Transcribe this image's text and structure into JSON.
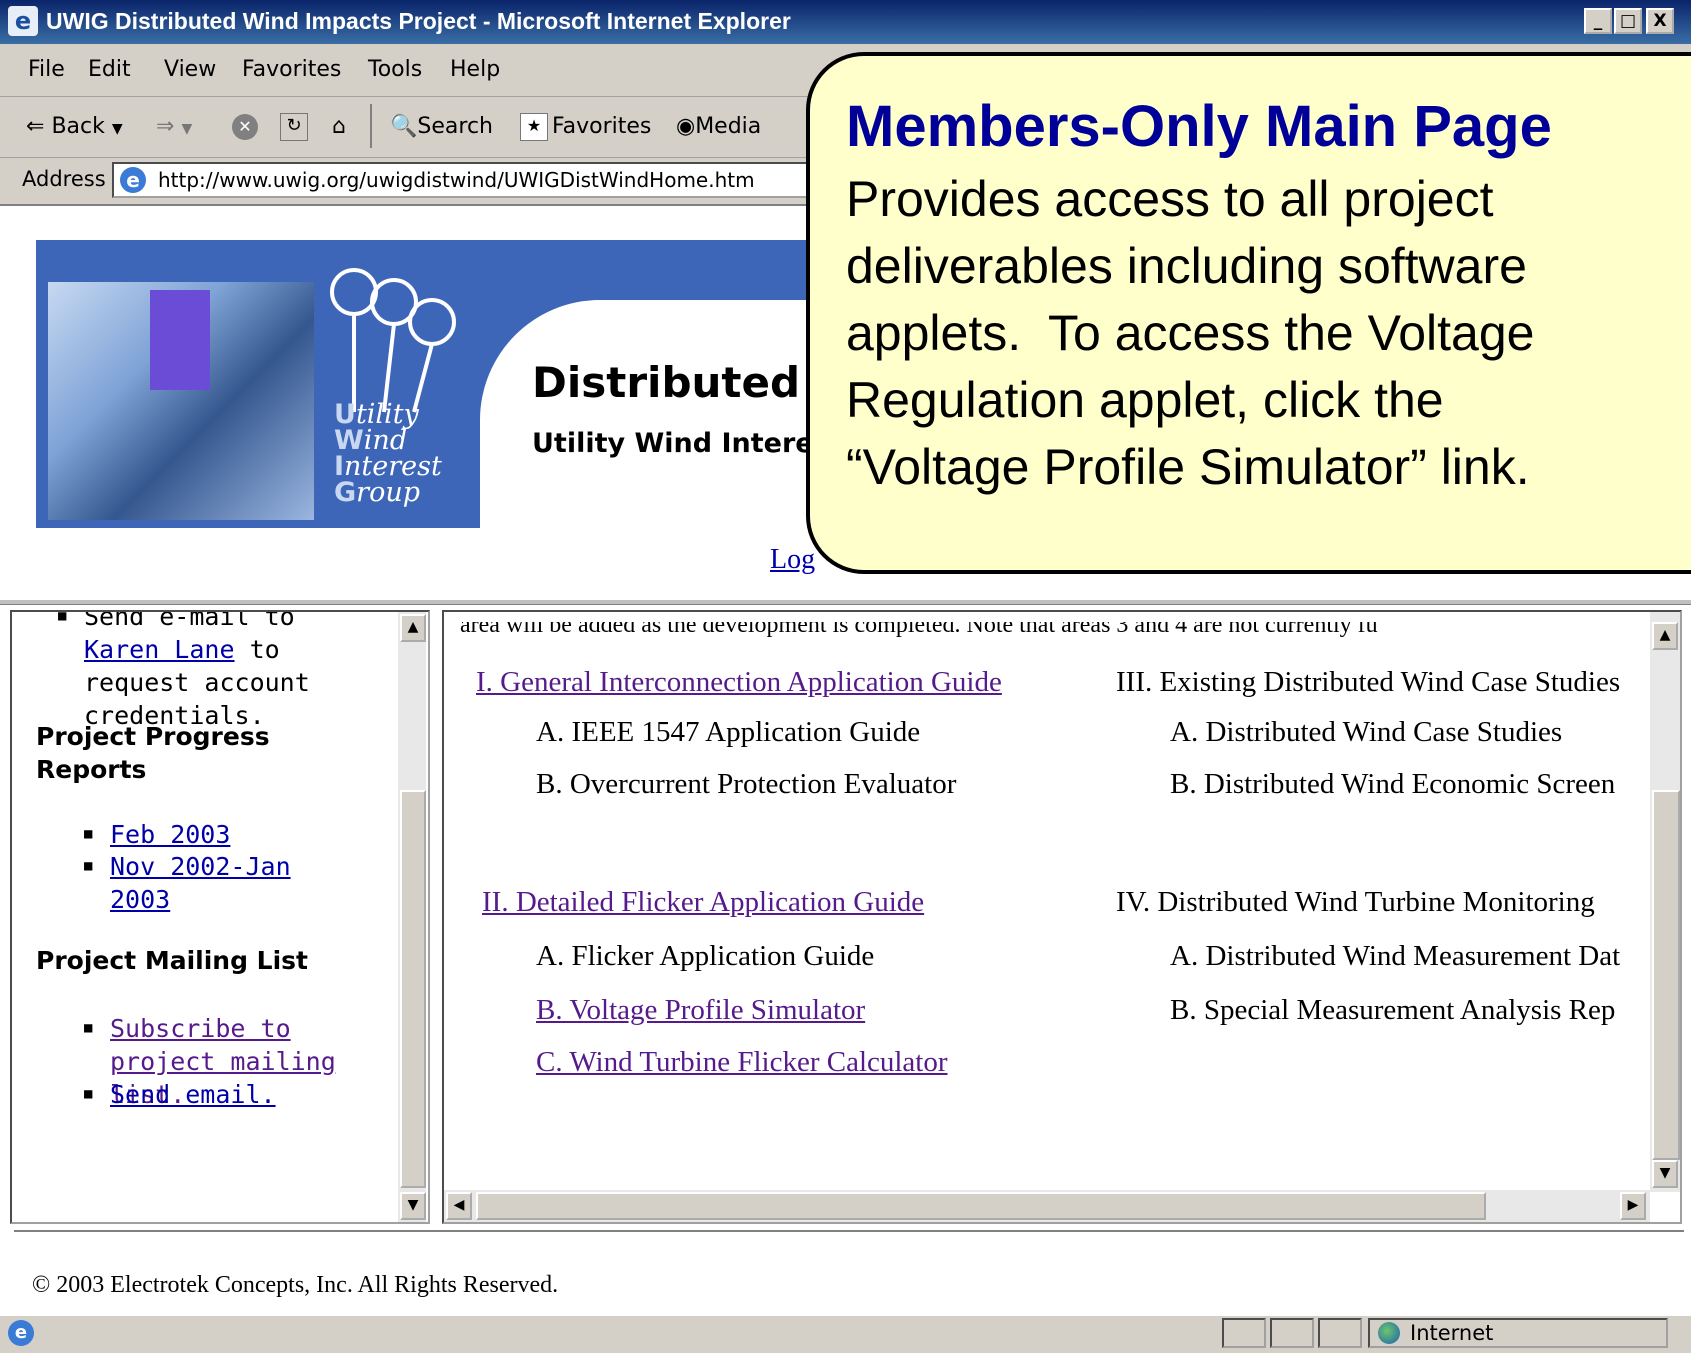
{
  "window": {
    "title": "UWIG Distributed Wind Impacts Project - Microsoft Internet Explorer",
    "controls": {
      "minimize": "_",
      "maximize": "□",
      "close": "X"
    }
  },
  "menubar": {
    "items": [
      "File",
      "Edit",
      "View",
      "Favorites",
      "Tools",
      "Help"
    ]
  },
  "toolbar": {
    "back": "Back",
    "search": "Search",
    "favorites": "Favorites",
    "media": "Media"
  },
  "address": {
    "label": "Address",
    "url": "http://www.uwig.org/uwigdistwind/UWIGDistWindHome.htm"
  },
  "banner": {
    "logo_lines": [
      "tility",
      "ind",
      "nterest",
      "roup"
    ],
    "logo_initials": [
      "U",
      "W",
      "I",
      "G"
    ],
    "title": "Distributed",
    "subtitle": "Utility Wind Intere",
    "login": "Log"
  },
  "left_frame": {
    "email_bullet": {
      "text_pre": "Send e-mail to",
      "link": "Karen Lane",
      "text_post": " to request account credentials."
    },
    "progress_heading": "Project Progress Reports",
    "progress_links": [
      "Feb 2003",
      "Nov 2002-Jan 2003"
    ],
    "mailing_heading": "Project Mailing List",
    "mailing_links": [
      "Subscribe to project mailing list.",
      "Send email."
    ]
  },
  "right_frame": {
    "cutoff_text": "area will be added as the development is completed. Note that areas 3 and 4 are not currently fu",
    "col1": {
      "section1": {
        "title": "I. General Interconnection Application Guide",
        "items": [
          "A. IEEE 1547 Application Guide",
          "B. Overcurrent Protection Evaluator"
        ]
      },
      "section2": {
        "title": "II. Detailed Flicker Application Guide",
        "items": [
          "A. Flicker Application Guide",
          "B. Voltage Profile Simulator",
          "C. Wind Turbine Flicker Calculator"
        ]
      }
    },
    "col2": {
      "section3": {
        "title": "III. Existing Distributed Wind Case Studies",
        "items": [
          "A. Distributed Wind Case Studies",
          "B. Distributed Wind Economic Screen"
        ]
      },
      "section4": {
        "title": "IV. Distributed Wind Turbine Monitoring",
        "items": [
          "A. Distributed Wind Measurement Dat",
          "B. Special Measurement Analysis Rep"
        ]
      }
    }
  },
  "footer": {
    "copyright": "© 2003 Electrotek Concepts, Inc. All Rights Reserved."
  },
  "statusbar": {
    "zone": "Internet"
  },
  "callout": {
    "title": "Members-Only Main Page",
    "body": "Provides access to all project\ndeliverables including software\napplets.  To access the Voltage\nRegulation applet, click the\n“Voltage Profile Simulator” link."
  },
  "colors": {
    "titlebar": "#0a246a",
    "callout_bg": "#ffffcc",
    "callout_title": "#000099",
    "banner_blue": "#3e66b8",
    "visited_link": "#551a8b",
    "link": "#0000aa"
  }
}
